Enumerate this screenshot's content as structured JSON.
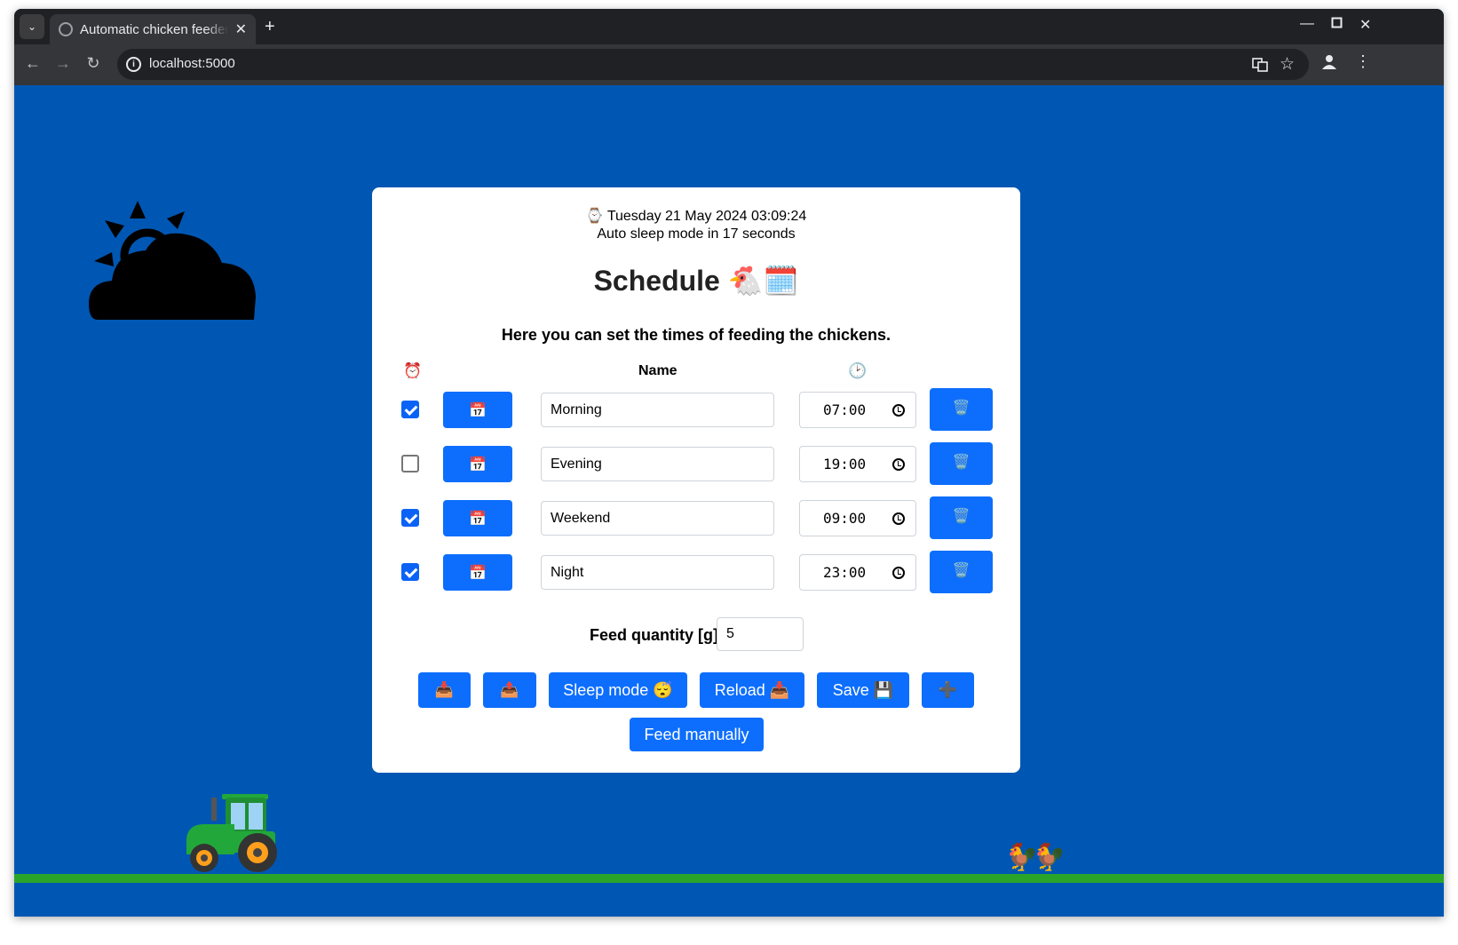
{
  "browser": {
    "tab_title": "Automatic chicken feeder",
    "url": "localhost:5000",
    "icons": [
      "tab-search-icon",
      "globe-icon",
      "close-icon",
      "new-tab-icon",
      "minimize-icon",
      "maximize-icon",
      "close-window-icon",
      "back-icon",
      "forward-icon",
      "reload-icon",
      "site-info-icon",
      "translate-icon",
      "bookmark-star-icon",
      "profile-icon",
      "menu-icon"
    ]
  },
  "page": {
    "clock": "⌚ Tuesday 21 May 2024 03:09:24",
    "sleep_notice": "Auto sleep mode in 17 seconds",
    "title": "Schedule 🐔🗓️",
    "intro": "Here you can set the times of feeding the chickens.",
    "columns": {
      "enabled_icon": "⏰",
      "name": "Name",
      "time_icon": "🕑"
    },
    "rows": [
      {
        "enabled": true,
        "calendar_label": "📅",
        "name": "Morning",
        "time": "07:00",
        "delete_label": "🗑️"
      },
      {
        "enabled": false,
        "calendar_label": "📅",
        "name": "Evening",
        "time": "19:00",
        "delete_label": "🗑️"
      },
      {
        "enabled": true,
        "calendar_label": "📅",
        "name": "Weekend",
        "time": "09:00",
        "delete_label": "🗑️"
      },
      {
        "enabled": true,
        "calendar_label": "📅",
        "name": "Night",
        "time": "23:00",
        "delete_label": "🗑️"
      }
    ],
    "feed_quantity_label": "Feed quantity [g]",
    "feed_quantity_value": "5",
    "buttons": {
      "download": "📥",
      "upload": "📤",
      "sleep": "Sleep mode 😴",
      "reload": "Reload 📥",
      "save": "Save 💾",
      "add": "➕",
      "feed": "Feed manually"
    },
    "decor": {
      "hens": "🐓🐓",
      "weather_icon": "partly-cloudy-icon",
      "tractor_icon": "tractor-icon"
    }
  },
  "colors": {
    "page_background": "#0057b3",
    "button_blue": "#0d6efd",
    "ground_green": "#2aa52a",
    "tractor_green": "#22a83a"
  }
}
